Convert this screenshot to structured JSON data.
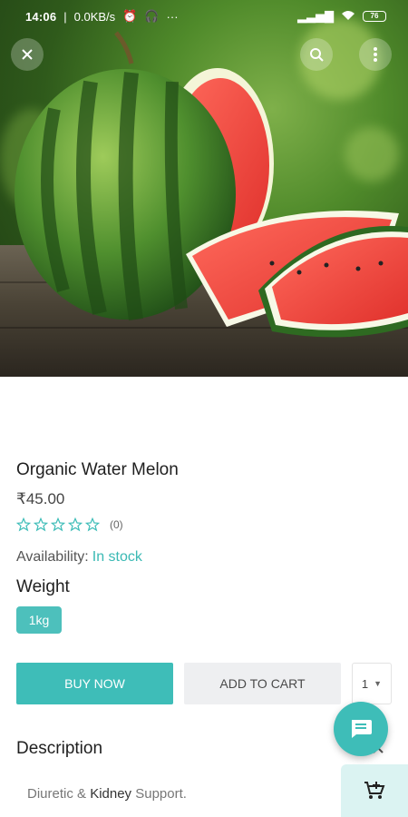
{
  "status_bar": {
    "time": "14:06",
    "speed": "0.0KB/s",
    "more": "···",
    "battery": "76"
  },
  "product": {
    "title": "Organic Water Melon",
    "price": "₹45.00",
    "rating_stars": 0,
    "rating_count": "(0)",
    "availability_label": "Availability:",
    "availability_value": "In stock",
    "weight_heading": "Weight",
    "weight_option": "1kg"
  },
  "actions": {
    "buy_now": "BUY NOW",
    "add_to_cart": "ADD TO CART",
    "quantity": "1"
  },
  "description": {
    "heading": "Description",
    "text_prefix": "Diuretic & ",
    "text_highlight": "Kidney",
    "text_suffix": " Support."
  },
  "icons": {
    "close": "close-icon",
    "search": "search-icon",
    "menu": "more-vert-icon",
    "chat": "chat-icon",
    "cart": "add-to-cart-icon"
  },
  "colors": {
    "accent": "#3ebdb8",
    "stock": "#3ab9b4",
    "cart_float_bg": "#dbf3f2"
  }
}
